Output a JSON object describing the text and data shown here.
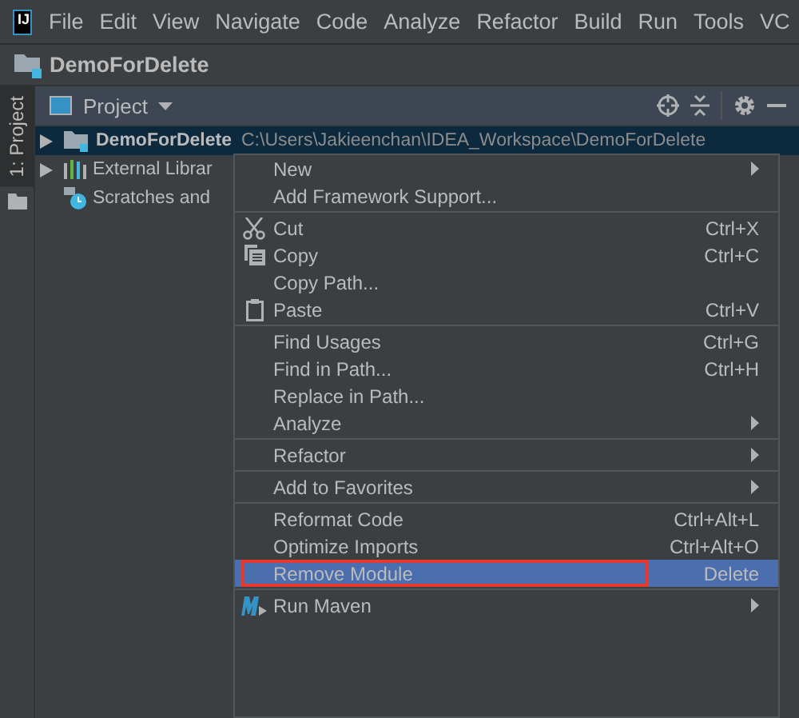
{
  "app": {
    "logo": "IJ"
  },
  "menubar": [
    {
      "label": "File"
    },
    {
      "label": "Edit"
    },
    {
      "label": "View"
    },
    {
      "label": "Navigate"
    },
    {
      "label": "Code"
    },
    {
      "label": "Analyze"
    },
    {
      "label": "Refactor"
    },
    {
      "label": "Build"
    },
    {
      "label": "Run"
    },
    {
      "label": "Tools"
    },
    {
      "label": "VC"
    }
  ],
  "navbar": {
    "title": "DemoForDelete"
  },
  "tool_strip": {
    "tab": {
      "label": "1: Project",
      "selected": true
    }
  },
  "project_panel": {
    "title": "Project",
    "tree": [
      {
        "label": "DemoForDelete",
        "path": "C:\\Users\\Jakieenchan\\IDEA_Workspace\\DemoForDelete",
        "kind": "module",
        "expanded": false,
        "selected": true
      },
      {
        "label": "External Librar",
        "kind": "libraries",
        "expanded": false,
        "selected": false
      },
      {
        "label": "Scratches and",
        "kind": "scratches",
        "selected": false
      }
    ]
  },
  "context_menu": {
    "groups": [
      [
        {
          "label": "New",
          "submenu": true,
          "selected": false,
          "outlined": false
        },
        {
          "label": "Add Framework Support...",
          "submenu": false,
          "selected": false,
          "outlined": false
        }
      ],
      [
        {
          "label": "Cut",
          "shortcut": "Ctrl+X",
          "submenu": false,
          "selected": false,
          "outlined": false
        },
        {
          "label": "Copy",
          "shortcut": "Ctrl+C",
          "submenu": false,
          "selected": false,
          "outlined": false
        },
        {
          "label": "Copy Path...",
          "submenu": false,
          "selected": false,
          "outlined": false
        },
        {
          "label": "Paste",
          "shortcut": "Ctrl+V",
          "submenu": false,
          "selected": false,
          "outlined": false
        }
      ],
      [
        {
          "label": "Find Usages",
          "shortcut": "Ctrl+G",
          "submenu": false,
          "selected": false,
          "outlined": false
        },
        {
          "label": "Find in Path...",
          "shortcut": "Ctrl+H",
          "submenu": false,
          "selected": false,
          "outlined": false
        },
        {
          "label": "Replace in Path...",
          "submenu": false,
          "selected": false,
          "outlined": false
        },
        {
          "label": "Analyze",
          "submenu": true,
          "selected": false,
          "outlined": false
        }
      ],
      [
        {
          "label": "Refactor",
          "submenu": true,
          "selected": false,
          "outlined": false
        }
      ],
      [
        {
          "label": "Add to Favorites",
          "submenu": true,
          "selected": false,
          "outlined": false
        }
      ],
      [
        {
          "label": "Reformat Code",
          "shortcut": "Ctrl+Alt+L",
          "submenu": false,
          "selected": false,
          "outlined": false
        },
        {
          "label": "Optimize Imports",
          "shortcut": "Ctrl+Alt+O",
          "submenu": false,
          "selected": false,
          "outlined": false
        },
        {
          "label": "Remove Module",
          "shortcut": "Delete",
          "submenu": false,
          "selected": true,
          "outlined": true
        }
      ],
      [
        {
          "label": "Run Maven",
          "submenu": true,
          "selected": false,
          "outlined": false
        }
      ]
    ]
  }
}
